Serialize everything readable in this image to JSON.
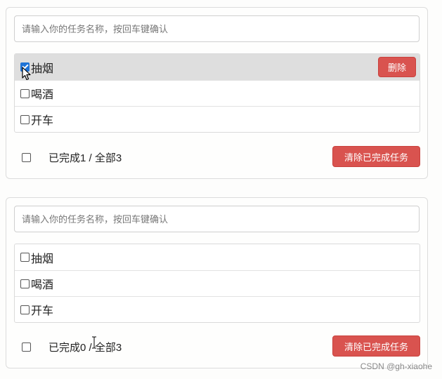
{
  "panels": [
    {
      "input": {
        "placeholder": "请输入你的任务名称，按回车键确认",
        "value": ""
      },
      "tasks": [
        {
          "label": "抽烟",
          "done": true,
          "hovered": true
        },
        {
          "label": "喝酒",
          "done": false
        },
        {
          "label": "开车",
          "done": false
        }
      ],
      "delete_label": "删除",
      "footer": {
        "status": "已完成1 / 全部3",
        "clear_label": "清除已完成任务",
        "all_checked": false
      }
    },
    {
      "input": {
        "placeholder": "请输入你的任务名称，按回车键确认",
        "value": ""
      },
      "tasks": [
        {
          "label": "抽烟",
          "done": false
        },
        {
          "label": "喝酒",
          "done": false
        },
        {
          "label": "开车",
          "done": false
        }
      ],
      "footer": {
        "status": "已完成0 / 全部3",
        "clear_label": "清除已完成任务",
        "all_checked": false
      }
    }
  ],
  "watermark": "CSDN @gh-xiaohe",
  "colors": {
    "danger": "#d9534f",
    "checkbox_checked": "#1e73d6",
    "row_hover": "#dedede"
  }
}
